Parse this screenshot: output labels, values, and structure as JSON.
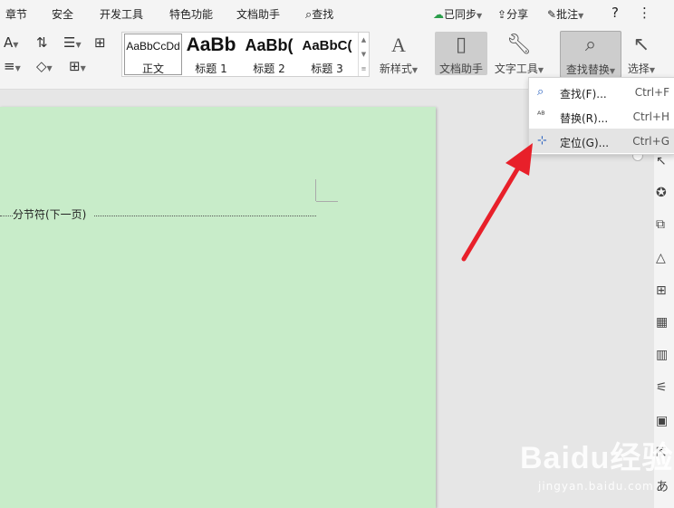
{
  "menubar": {
    "items": [
      "章节",
      "安全",
      "开发工具",
      "特色功能",
      "文档助手"
    ],
    "search_label": "查找",
    "sync_label": "已同步",
    "share_label": "分享",
    "comment_label": "批注",
    "help_icon": "?",
    "more_icon": "⋮"
  },
  "ribbon": {
    "styles": [
      {
        "sample": "AaBbCcDd",
        "name": "正文"
      },
      {
        "sample": "AaBb",
        "name": "标题 1"
      },
      {
        "sample": "AaBb(",
        "name": "标题 2"
      },
      {
        "sample": "AaBbC(",
        "name": "标题 3"
      }
    ],
    "new_style_label": "新样式",
    "doc_helper_label": "文档助手",
    "text_tools_label": "文字工具",
    "find_replace_label": "查找替换",
    "select_label": "选择"
  },
  "dropdown": {
    "items": [
      {
        "label": "查找(F)...",
        "shortcut": "Ctrl+F"
      },
      {
        "label": "替换(R)...",
        "shortcut": "Ctrl+H"
      },
      {
        "label": "定位(G)...",
        "shortcut": "Ctrl+G"
      }
    ]
  },
  "document": {
    "section_break_text": "分节符(下一页)"
  },
  "watermark": {
    "brand": "Baidu经验",
    "url": "jingyan.baidu.com"
  },
  "colors": {
    "page_background": "#c8ecc9",
    "arrow": "#e8202a",
    "accent": "#2b62c0"
  }
}
